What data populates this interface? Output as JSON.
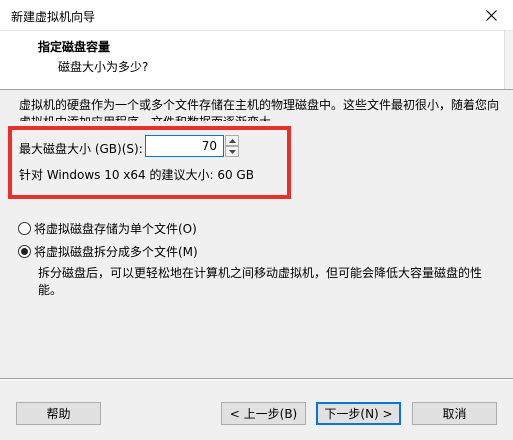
{
  "window": {
    "title": "新建虚拟机向导"
  },
  "header": {
    "title": "指定磁盘容量",
    "subtitle": "磁盘大小为多少?"
  },
  "description": "虚拟机的硬盘作为一个或多个文件存储在主机的物理磁盘中。这些文件最初很小，随着您向虚拟机中添加应用程序、文件和数据而逐渐变大。",
  "disk_size": {
    "label": "最大磁盘大小 (GB)(S):",
    "value": "70",
    "recommendation": "针对 Windows 10 x64 的建议大小: 60 GB"
  },
  "options": [
    {
      "label": "将虚拟磁盘存储为单个文件(O)",
      "selected": false
    },
    {
      "label": "将虚拟磁盘拆分成多个文件(M)",
      "selected": true
    }
  ],
  "split_description": "拆分磁盘后，可以更轻松地在计算机之间移动虚拟机，但可能会降低大容量磁盘的性能。",
  "buttons": {
    "help": "帮助",
    "back": "< 上一步(B)",
    "next": "下一步(N) >",
    "cancel": "取消"
  },
  "colors": {
    "highlight": "#e8312d",
    "focus": "#0078d7"
  }
}
